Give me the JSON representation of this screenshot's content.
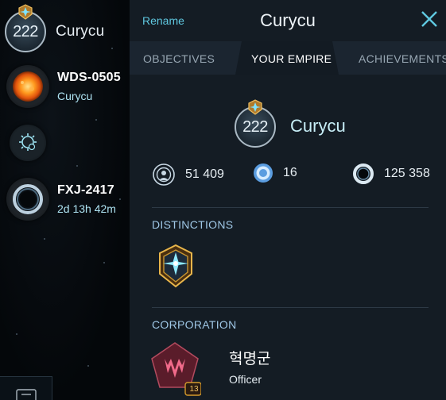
{
  "sidebar": {
    "player": {
      "level": "222",
      "name": "Curycu"
    },
    "items": [
      {
        "icon": "sun-planet-icon",
        "title": "WDS-0505",
        "subtitle": "Curycu"
      },
      {
        "icon": "settings-gear-icon"
      },
      {
        "icon": "wormhole-portal-icon",
        "title": "FXJ-2417",
        "subtitle": "2d 13h 42m"
      }
    ],
    "menu_icon": "menu-icon"
  },
  "panel": {
    "rename_label": "Rename",
    "title": "Curycu",
    "tabs": [
      {
        "label": "OBJECTIVES",
        "active": false
      },
      {
        "label": "YOUR EMPIRE",
        "active": true
      },
      {
        "label": "ACHIEVEMENTS",
        "active": false
      }
    ],
    "empire": {
      "level": "222",
      "name": "Curycu",
      "stats": [
        {
          "icon": "influence-icon",
          "value": "51 409"
        },
        {
          "icon": "credits-icon",
          "value": "16"
        },
        {
          "icon": "antimatter-ring-icon",
          "value": "125 358"
        }
      ]
    },
    "distinctions": {
      "label": "DISTINCTIONS",
      "badges": [
        "star-crest-icon"
      ]
    },
    "corporation": {
      "label": "CORPORATION",
      "name": "혁명군",
      "role": "Officer",
      "level": "13"
    }
  },
  "colors": {
    "accent": "#5fc8e0",
    "panel_bg": "#141c24",
    "tab_bar_bg": "#1b2530",
    "active_tab_bg": "#131b23",
    "corp_emblem": "#7a2538",
    "badge_gold": "#d49a2c"
  }
}
